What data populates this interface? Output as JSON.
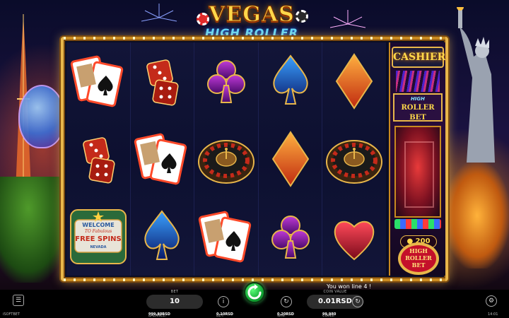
{
  "game": {
    "title_line1": "VEGAS",
    "title_line2": "HIGH ROLLER"
  },
  "reels": [
    [
      "cards",
      "dice",
      "free_spins"
    ],
    [
      "dice",
      "cards",
      "spade"
    ],
    [
      "club",
      "roulette",
      "cards"
    ],
    [
      "spade",
      "diamond",
      "club"
    ],
    [
      "diamond",
      "roulette",
      "heart"
    ]
  ],
  "scatter": {
    "line1": "WELCOME",
    "line2": "TO",
    "line3": "Fabulous",
    "line4": "FREE SPINS",
    "line5": "NEVADA"
  },
  "side_panel": {
    "cashier_label": "CASHIER",
    "high_roller_bet_line1": "HIGH",
    "high_roller_bet_line2": "ROLLER BET",
    "bet_amount": "200",
    "button_line1": "HIGH",
    "button_line2": "ROLLER",
    "button_line3": "BET"
  },
  "win_message": "You won line 4 !",
  "controls": {
    "bet_label": "BET",
    "bet_value": "10",
    "coin_value_label": "COIN VALUE",
    "coin_value": "0.01RSD"
  },
  "info_bar": {
    "brand": "iSOFTBET",
    "balance_label": "BALANCE:",
    "balance_value": "999.80RSD",
    "bet_label": "BET:",
    "bet_value": "0.10RSD",
    "win_label": "WIN:",
    "win_value": "0.20RSD",
    "coins_label": "COINS:",
    "coins_value": "99,980",
    "clock": "14:01"
  },
  "colors": {
    "frame_gold": "#e8b64a",
    "spin_green": "#12a834",
    "reel_bg": "#0d1030"
  }
}
